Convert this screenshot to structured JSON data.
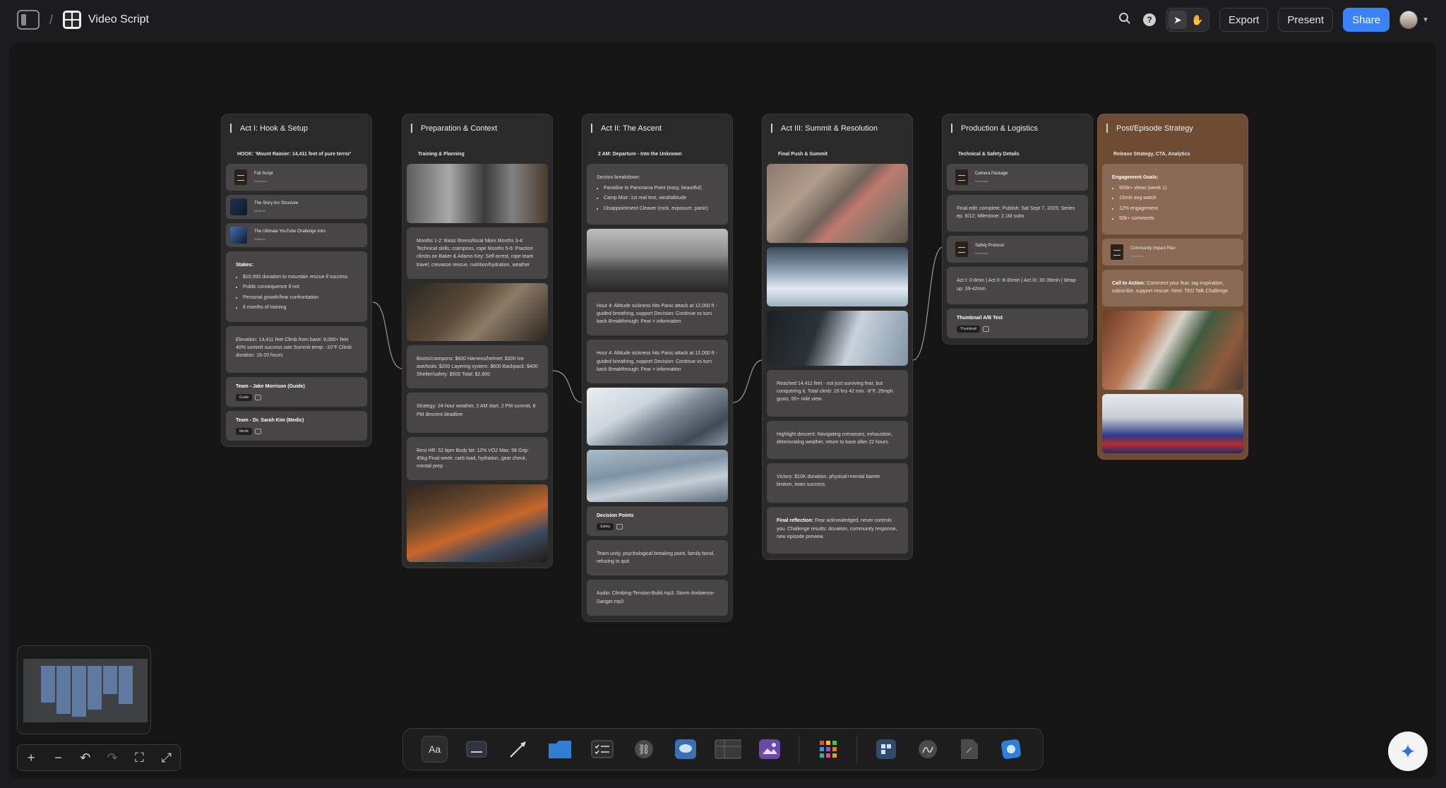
{
  "header": {
    "title": "Video Script",
    "export_label": "Export",
    "present_label": "Present",
    "share_label": "Share",
    "help_glyph": "?"
  },
  "columns": [
    {
      "title": "Act I: Hook & Setup",
      "subtitle": "HOOK: 'Mount Rainier: 14,411 feet of pure terror'",
      "docs": [
        {
          "title": "Full Script",
          "kind": "Document"
        },
        {
          "title": "The Story Arc Structure",
          "kind": "Blueprint"
        },
        {
          "title": "The Ultimate YouTube Challenge Intro",
          "kind": "Blueprint"
        }
      ],
      "stakes_label": "Stakes:",
      "stakes": [
        "$10,000 donation to mountain rescue if success",
        "Public consequence if not",
        "Personal growth/fear confrontation",
        "6 months of training"
      ],
      "elevation": "Elevation: 14,411 feet Climb from base: 9,000+ feet 40% summit success rate Summit temp: -10°F Climb duration: 16-20 hours",
      "team": [
        {
          "name": "Team - Jake Morrison (Guide)",
          "chip": "Guide"
        },
        {
          "name": "Team - Dr. Sarah Kim (Medic)",
          "chip": "Medic"
        }
      ]
    },
    {
      "title": "Preparation & Context",
      "subtitle": "Training & Planning",
      "training": "Months 1-2: Basic fitness/local hikes Months 3-4: Technical skills: crampons, rope Months 5-6: Practice climbs on Baker & Adams Key: Self-arrest, rope team travel, crevasse rescue, nutrition/hydration, weather",
      "gear": "Boots/crampons: $600 Harness/helmet: $300 Ice axe/tools: $200 Layering system: $600 Backpack: $400 Shelter/safety: $500 Total: $2,800",
      "strategy": "Strategy: 24-hour weather, 2 AM start, 2 PM summit, 8 PM descent deadline",
      "stats": "Rest HR: 52 bpm Body fat: 12% VO2 Max: 58 Grip: 45kg Final week: carb load, hydration, gear check, mental prep"
    },
    {
      "title": "Act II: The Ascent",
      "subtitle": "2 AM: Departure - Into the Unknown",
      "section_label": "Section breakdown:",
      "sections": [
        "Paradise to Panorama Point (easy, beautiful)",
        "Camp Muir: 1st real test, wind/altitude",
        "Disappointment Cleaver (rock, exposure, panic)"
      ],
      "hour4_a": "Hour 4: Altitude sickness hits Panic attack at 12,000 ft - guided breathing, support Decision: Continue vs turn back Breakthrough: Fear = information",
      "hour4_b": "Hour 4: Altitude sickness hits Panic attack at 12,000 ft - guided breathing, support Decision: Continue vs turn back Breakthrough: Fear = information",
      "decision_title": "Decision Points",
      "decision_chip": "Safety",
      "team_unity": "Team unity, psychological breaking point, family bond, refusing to quit.",
      "audio": "Audio: Climbing-Tension-Build.mp3, Storm-Ambience-Danger.mp3"
    },
    {
      "title": "Act III: Summit & Resolution",
      "subtitle": "Final Push & Summit",
      "reached": "Reached 14,411 feet - not just surviving fear, but conquering it. Total climb: 16 hrs 42 min. -8°F, 25mph gusts, 50+ mile view.",
      "descent": "Highlight descent: Navigating crevasses, exhaustion, deteriorating weather, return to base after 22 hours.",
      "victory": "Victory: $10K donation, physical+mental barrier broken, team success.",
      "reflection_label": "Final reflection:",
      "reflection": " Fear acknowledged, never controls you. Challenge results: donation, community response, new episode preview."
    },
    {
      "title": "Production & Logistics",
      "subtitle": "Technical & Safety Details",
      "docs": [
        {
          "title": "Camera Package",
          "kind": "Document"
        },
        {
          "title": "Safety Protocol",
          "kind": "Document"
        }
      ],
      "final_edit": "Final edit: complete; Publish: Sat Sept 7, 2025; Series ep. 8/12; Milestone: 2.1M subs",
      "runtime": "Act I: 0-8min | Act II: 8-30min | Act III: 30-39min | Wrap-up: 39-42min",
      "thumb_title": "Thumbnail A/B Test",
      "thumb_chip": "Thumbnail"
    },
    {
      "title": "Post/Episode Strategy",
      "subtitle": "Release Strategy, CTA, Analytics",
      "goals_label": "Engagement Goals:",
      "goals": [
        "500k+ views (week 1)",
        "15min avg watch",
        "12% engagement",
        "50k+ comments"
      ],
      "doc": {
        "title": "Community Impact Plan",
        "kind": "Document"
      },
      "cta_label": "Call to Action:",
      "cta": " Comment your fear, tag inspiration, subscribe, support rescue. Next: TED Talk Challenge."
    }
  ],
  "dock": {
    "text_tool": "Aa"
  },
  "zoom": {
    "plus": "+",
    "minus": "−"
  }
}
